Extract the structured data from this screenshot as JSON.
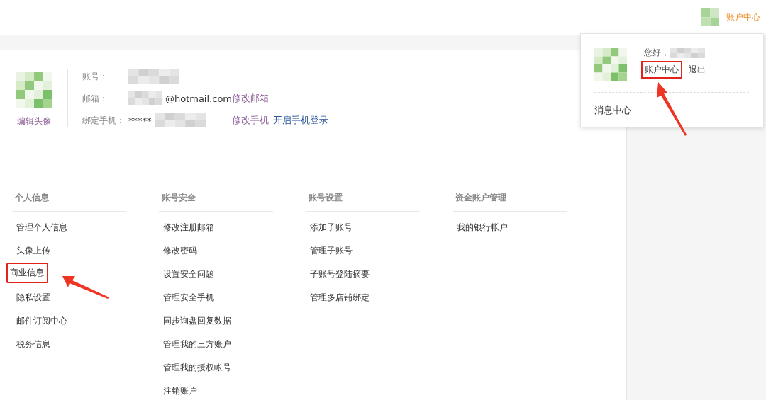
{
  "header": {
    "account_link": "账户中心"
  },
  "profile": {
    "avatar_caption": "编辑头像",
    "fields": [
      {
        "label": "账号："
      },
      {
        "label": "邮箱：",
        "value": "@hotmail.com",
        "links": [
          {
            "text": "修改邮箱",
            "kind": "edit"
          }
        ]
      },
      {
        "label": "绑定手机：",
        "value": "*****",
        "links": [
          {
            "text": "修改手机",
            "kind": "edit"
          },
          {
            "text": "开启手机登录",
            "kind": "action"
          }
        ]
      }
    ]
  },
  "menus": [
    {
      "title": "个人信息",
      "items": [
        {
          "label": "管理个人信息",
          "highlighted": false
        },
        {
          "label": "头像上传",
          "highlighted": false
        },
        {
          "label": "商业信息",
          "highlighted": true
        },
        {
          "label": "隐私设置",
          "highlighted": false
        },
        {
          "label": "邮件订阅中心",
          "highlighted": false
        },
        {
          "label": "税务信息",
          "highlighted": false
        }
      ]
    },
    {
      "title": "账号安全",
      "items": [
        {
          "label": "修改注册邮箱",
          "highlighted": false
        },
        {
          "label": "修改密码",
          "highlighted": false
        },
        {
          "label": "设置安全问题",
          "highlighted": false
        },
        {
          "label": "管理安全手机",
          "highlighted": false
        },
        {
          "label": "同步询盘回复数据",
          "highlighted": false
        },
        {
          "label": "管理我的三方账户",
          "highlighted": false
        },
        {
          "label": "管理我的授权帐号",
          "highlighted": false
        },
        {
          "label": "注销账户",
          "highlighted": false
        }
      ]
    },
    {
      "title": "账号设置",
      "items": [
        {
          "label": "添加子账号",
          "highlighted": false
        },
        {
          "label": "管理子账号",
          "highlighted": false
        },
        {
          "label": "子账号登陆摘要",
          "highlighted": false
        },
        {
          "label": "管理多店铺绑定",
          "highlighted": false
        }
      ]
    },
    {
      "title": "资金账户管理",
      "items": [
        {
          "label": "我的银行帐户",
          "highlighted": false
        }
      ]
    }
  ],
  "dropdown": {
    "greeting": "您好，",
    "links": [
      {
        "text": "账户中心",
        "highlighted": true
      },
      {
        "text": "退出",
        "highlighted": false
      }
    ],
    "message_center": "消息中心"
  }
}
